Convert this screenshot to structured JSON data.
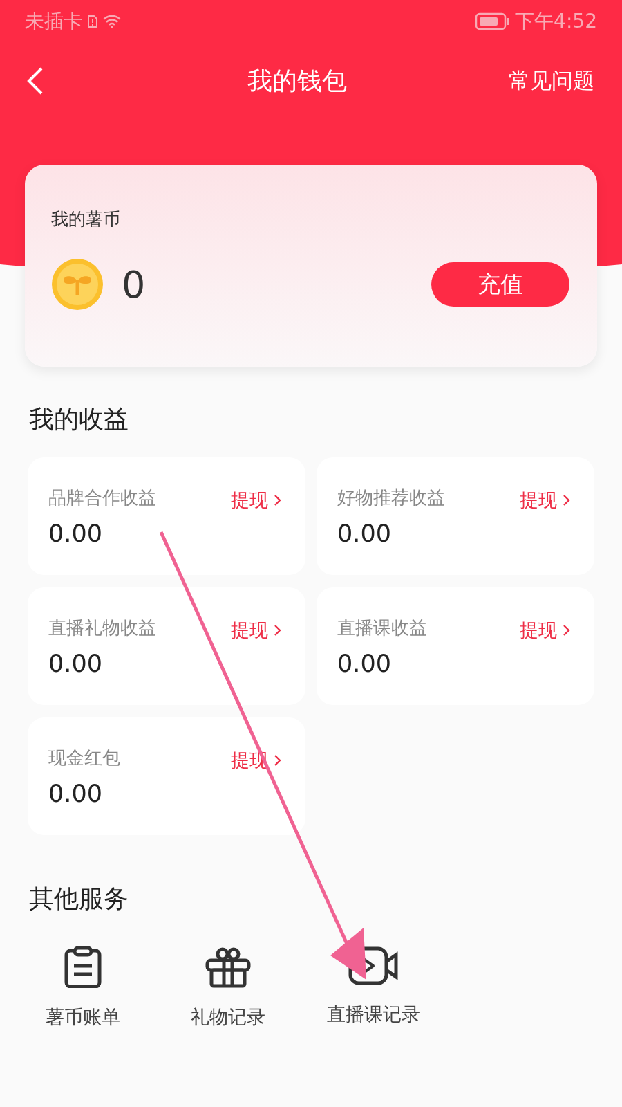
{
  "status_bar": {
    "carrier": "未插卡",
    "time": "下午4:52"
  },
  "header": {
    "title": "我的钱包",
    "action": "常见问题"
  },
  "coins": {
    "label": "我的薯币",
    "amount": "0",
    "button": "充值"
  },
  "earnings": {
    "title": "我的收益",
    "items": [
      {
        "name": "品牌合作收益",
        "amount": "0.00",
        "action": "提现"
      },
      {
        "name": "好物推荐收益",
        "amount": "0.00",
        "action": "提现"
      },
      {
        "name": "直播礼物收益",
        "amount": "0.00",
        "action": "提现"
      },
      {
        "name": "直播课收益",
        "amount": "0.00",
        "action": "提现"
      },
      {
        "name": "现金红包",
        "amount": "0.00",
        "action": "提现"
      }
    ]
  },
  "services": {
    "title": "其他服务",
    "items": [
      {
        "kind": "bill",
        "label": "薯币账单"
      },
      {
        "kind": "gift",
        "label": "礼物记录"
      },
      {
        "kind": "video",
        "label": "直播课记录"
      }
    ]
  }
}
